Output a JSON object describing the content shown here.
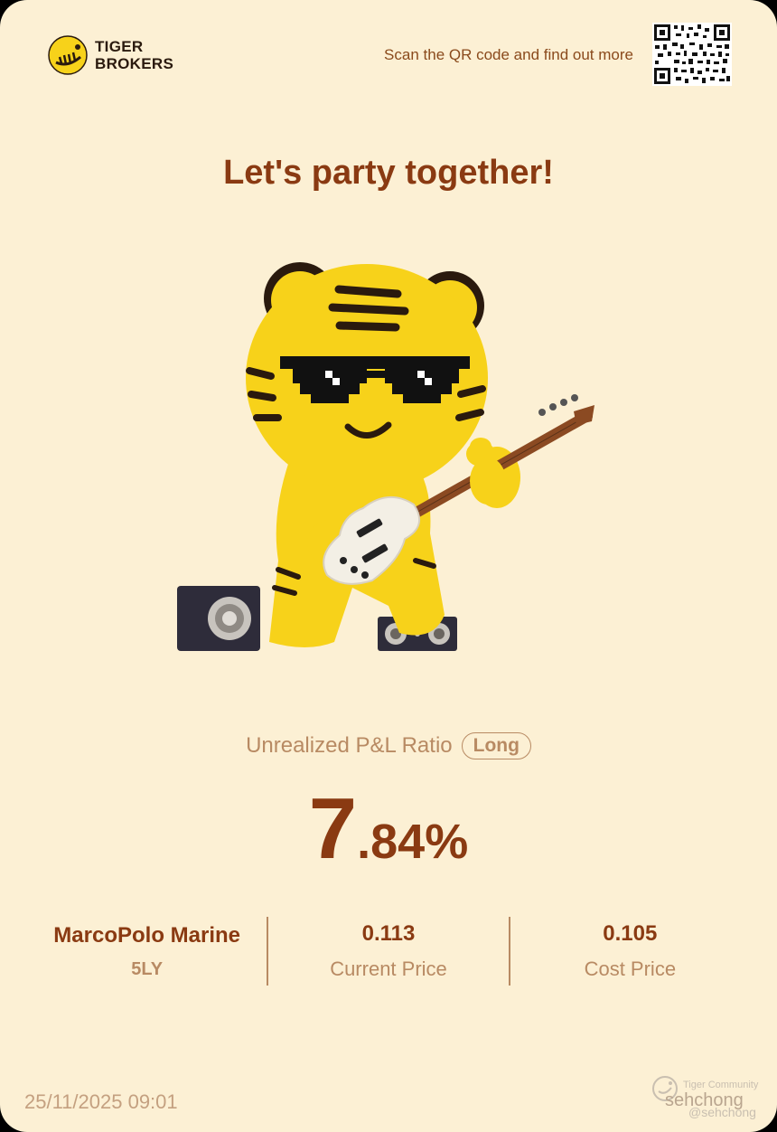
{
  "brand": {
    "line1": "TIGER",
    "line2": "BROKERS"
  },
  "qr_caption": "Scan the QR code and find out more",
  "headline": "Let's party together!",
  "pnl": {
    "label": "Unrealized P&L Ratio",
    "badge": "Long",
    "value_int": "7",
    "value_frac": ".84%"
  },
  "stock": {
    "name": "MarcoPolo Marine",
    "ticker": "5LY"
  },
  "current_price": {
    "value": "0.113",
    "label": "Current Price"
  },
  "cost_price": {
    "value": "0.105",
    "label": "Cost Price"
  },
  "timestamp": "25/11/2025 09:01",
  "watermark": {
    "brand": "Tiger Community",
    "user": "sehchong",
    "handle": "@sehchong"
  },
  "colors": {
    "background": "#fcf0d4",
    "primary": "#8a3a12",
    "muted": "#b88a63",
    "tiger_yellow": "#f7d21a"
  }
}
